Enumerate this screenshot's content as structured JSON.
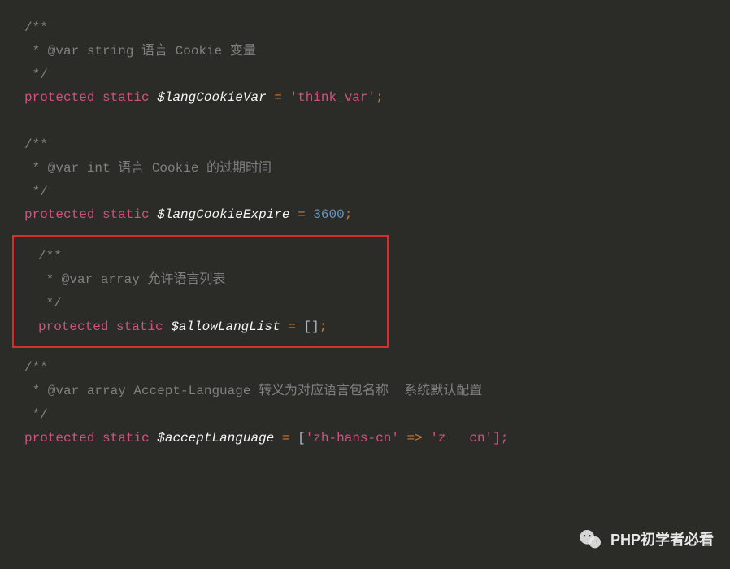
{
  "code": {
    "block1": {
      "comment_open": "/**",
      "comment_line": " * @var string 语言 Cookie 变量",
      "comment_close": " */",
      "protected": "protected",
      "static": "static",
      "variable": "$langCookieVar",
      "equals": " = ",
      "value": "'think_var'",
      "semi": ";"
    },
    "block2": {
      "comment_open": "/**",
      "comment_line": " * @var int 语言 Cookie 的过期时间",
      "comment_close": " */",
      "protected": "protected",
      "static": "static",
      "variable": "$langCookieExpire",
      "equals": " = ",
      "value": "3600",
      "semi": ";"
    },
    "block3": {
      "comment_open": "/**",
      "comment_line": " * @var array 允许语言列表",
      "comment_close": " */",
      "protected": "protected",
      "static": "static",
      "variable": "$allowLangList",
      "equals": " = ",
      "value": "[]",
      "semi": ";"
    },
    "block4": {
      "comment_open": "/**",
      "comment_line": " * @var array Accept-Language 转义为对应语言包名称  系统默认配置",
      "comment_close": " */",
      "protected": "protected",
      "static": "static",
      "variable": "$acceptLanguage",
      "equals": " = ",
      "bracket_open": "[",
      "key": "'zh-hans-cn'",
      "arrow": " => ",
      "val_partial": "'z",
      "val_partial2": "cn'];"
    }
  },
  "watermark": {
    "text": "PHP初学者必看"
  }
}
